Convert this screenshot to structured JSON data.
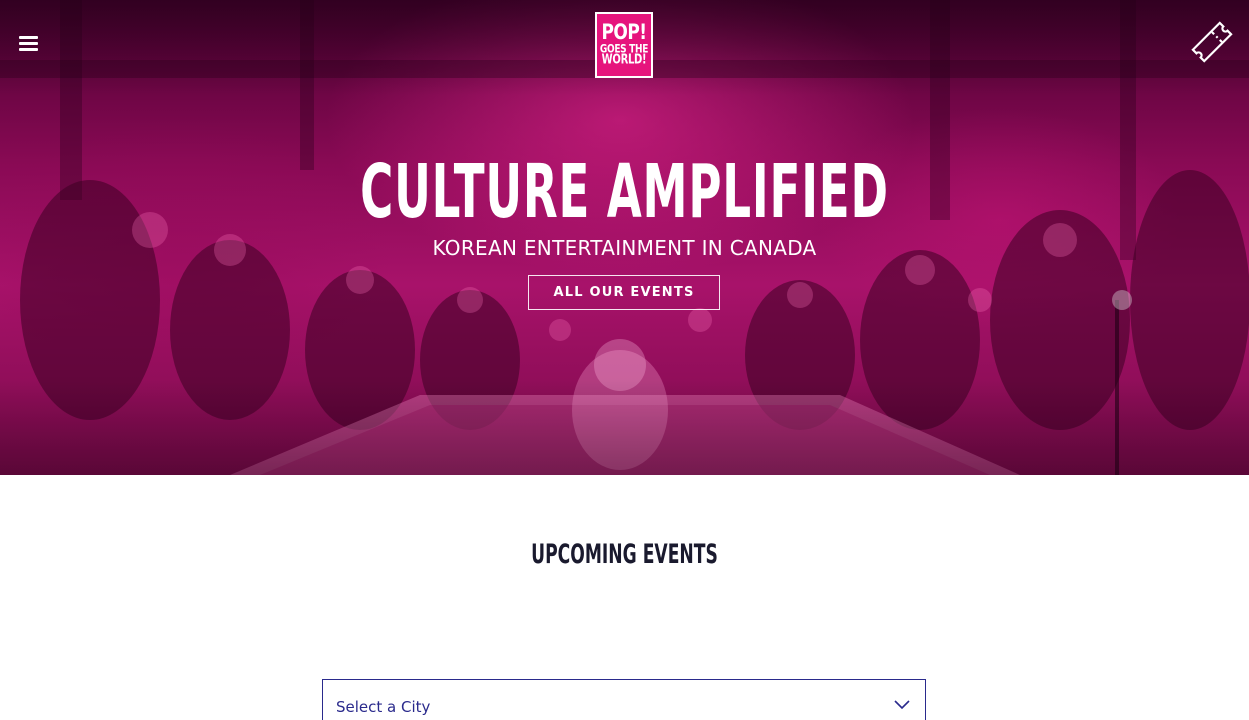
{
  "header": {
    "menu_icon": "hamburger-menu-icon",
    "logo": {
      "line1": "POP!",
      "line2": "GOES THE",
      "line3": "WORLD!"
    },
    "ticket_icon": "ticket-icon"
  },
  "hero": {
    "title": "CULTURE AMPLIFIED",
    "subtitle": "KOREAN ENTERTAINMENT IN CANADA",
    "cta_label": "ALL OUR EVENTS",
    "accent_color": "#e6147d"
  },
  "events": {
    "section_title": "UPCOMING EVENTS",
    "city_select": {
      "placeholder": "Select a City",
      "chevron_icon": "chevron-down-icon",
      "border_color": "#2a2a8c"
    }
  }
}
